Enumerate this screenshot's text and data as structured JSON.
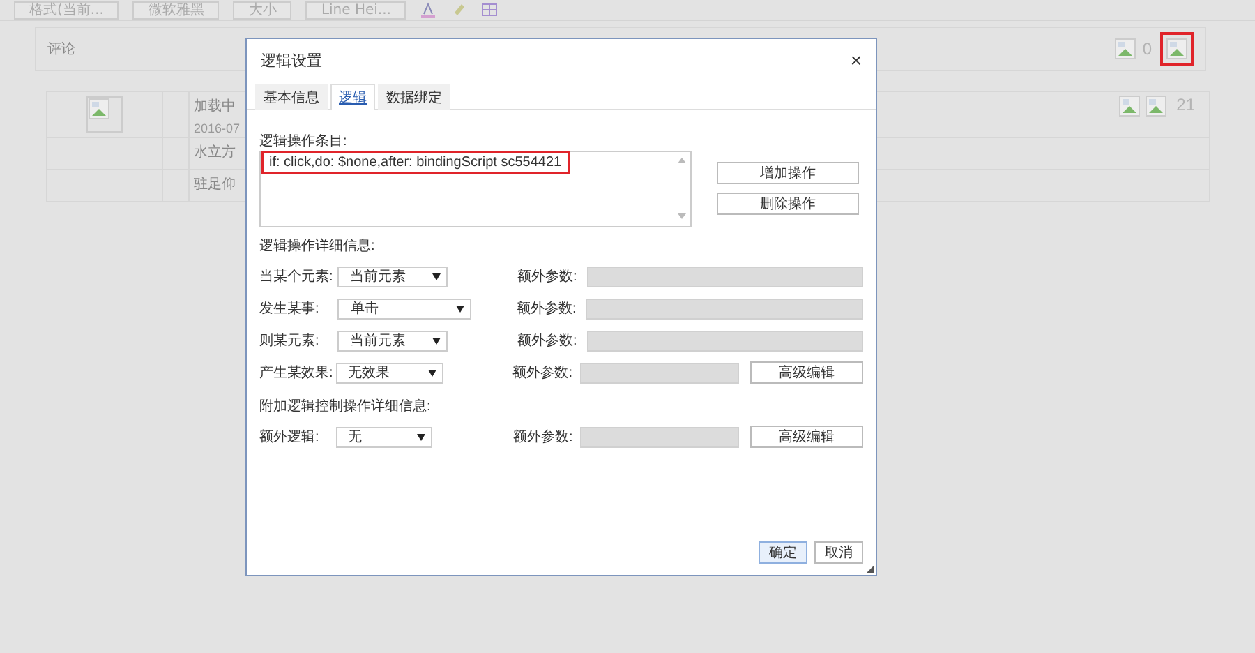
{
  "toolbar": {
    "buttons": [
      "格式(当前...",
      "微软雅黑",
      "大小",
      "Line Hei..."
    ]
  },
  "comment_bar": {
    "label": "评论",
    "count": "0",
    "icon_highlighted": true
  },
  "feed": {
    "rows": [
      {
        "kind": "post",
        "title": "加载中",
        "date": "2016-07",
        "count": "21"
      },
      {
        "kind": "text",
        "title": "水立方"
      },
      {
        "kind": "text",
        "title": "驻足仰"
      }
    ]
  },
  "dialog": {
    "title": "逻辑设置",
    "close": "×",
    "tabs": [
      {
        "label": "基本信息",
        "selected": false
      },
      {
        "label": "逻辑",
        "selected": true
      },
      {
        "label": "数据绑定",
        "selected": false
      }
    ],
    "entries_label": "逻辑操作条目:",
    "entries": [
      {
        "text": "if: click,do: $none,after: bindingScript sc554421",
        "highlighted": true
      }
    ],
    "entry_buttons": [
      "增加操作",
      "删除操作"
    ],
    "details_label": "逻辑操作详细信息:",
    "rows": [
      {
        "kind": "plain",
        "label": "当某个元素:",
        "value": "当前元素",
        "param_label": "额外参数:"
      },
      {
        "kind": "plain",
        "label": "发生某事:",
        "value": "单击",
        "param_label": "额外参数:"
      },
      {
        "kind": "plain",
        "label": "则某元素:",
        "value": "当前元素",
        "param_label": "额外参数:"
      },
      {
        "kind": "advanced",
        "label": "产生某效果:",
        "value": "无效果",
        "param_label": "额外参数:",
        "button": "高级编辑"
      }
    ],
    "extra_label": "附加逻辑控制操作详细信息:",
    "extra_rows": [
      {
        "kind": "advanced",
        "label": "额外逻辑:",
        "value": "无",
        "param_label": "额外参数:",
        "button": "高级编辑"
      }
    ],
    "footer_buttons": [
      {
        "label": "确定",
        "primary": true
      },
      {
        "label": "取消",
        "primary": false
      }
    ]
  }
}
